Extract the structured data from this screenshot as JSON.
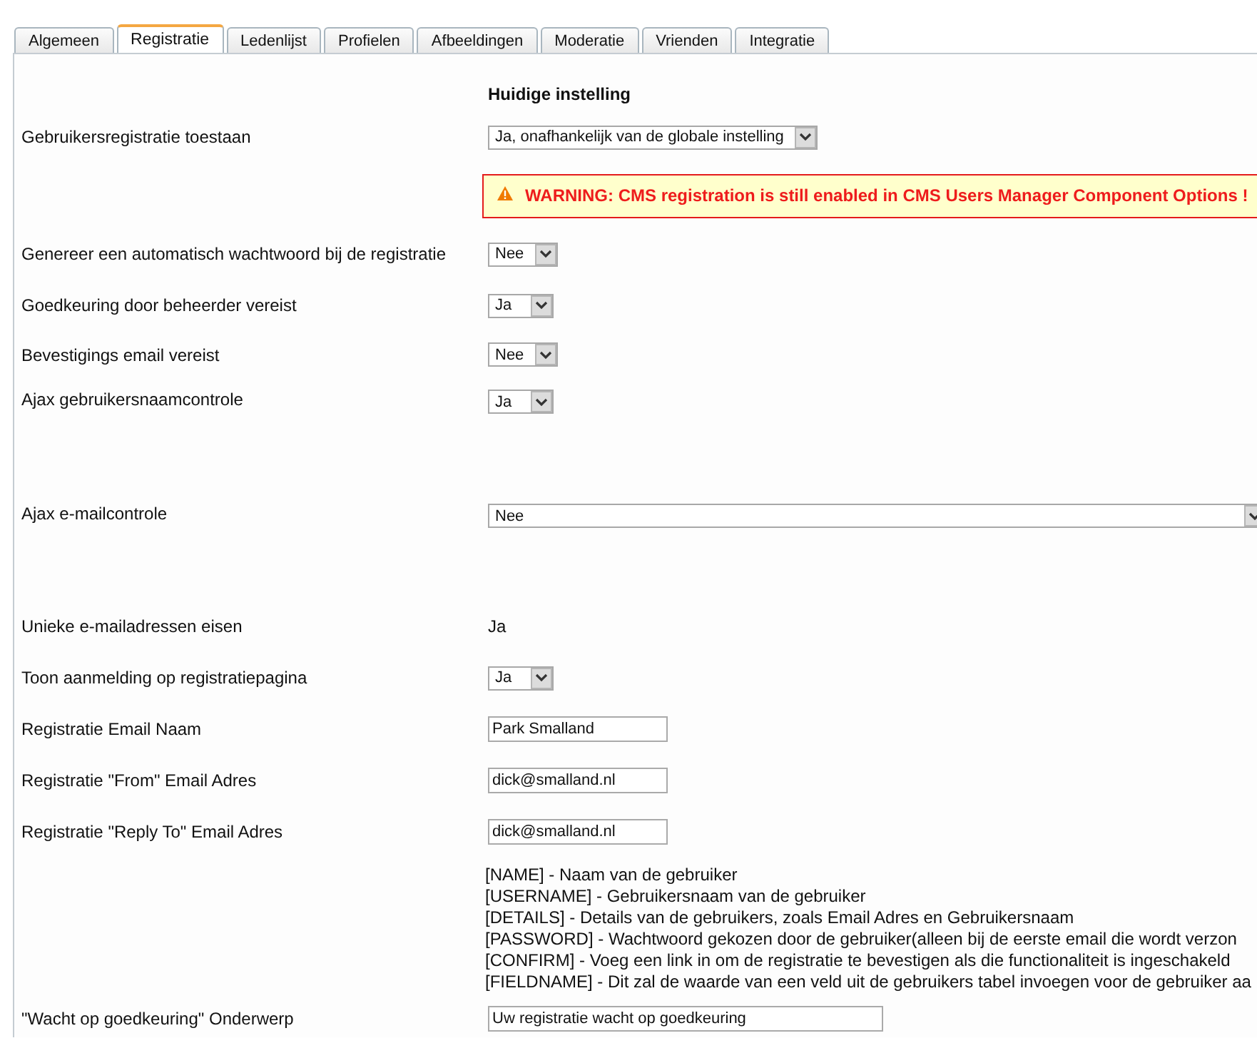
{
  "tabs": [
    {
      "label": "Algemeen",
      "selected": false
    },
    {
      "label": "Registratie",
      "selected": true
    },
    {
      "label": "Ledenlijst",
      "selected": false
    },
    {
      "label": "Profielen",
      "selected": false
    },
    {
      "label": "Afbeeldingen",
      "selected": false
    },
    {
      "label": "Moderatie",
      "selected": false
    },
    {
      "label": "Vrienden",
      "selected": false
    },
    {
      "label": "Integratie",
      "selected": false
    }
  ],
  "column_heading": "Huidige instelling",
  "rows": [
    {
      "kind": "select",
      "label": "Gebruikersregistratie toestaan",
      "value": "Ja, onafhankelijk van de globale instelling"
    },
    {
      "kind": "warning",
      "text": "WARNING: CMS registration is still enabled in CMS Users Manager Component Options !"
    },
    {
      "kind": "select",
      "label": "Genereer een automatisch wachtwoord bij de registratie",
      "value": "Nee"
    },
    {
      "kind": "select",
      "label": "Goedkeuring door beheerder vereist",
      "value": "Ja"
    },
    {
      "kind": "select",
      "label": "Bevestigings email vereist",
      "value": "Nee"
    },
    {
      "kind": "select",
      "label": "Ajax gebruikersnaamcontrole",
      "value": "Ja"
    },
    {
      "kind": "wide_select",
      "label": "Ajax e-mailcontrole",
      "value": "Nee"
    },
    {
      "kind": "text",
      "label": "Unieke e-mailadressen eisen",
      "value": "Ja"
    },
    {
      "kind": "select",
      "label": "Toon aanmelding op registratiepagina",
      "value": "Ja"
    },
    {
      "kind": "input",
      "label": "Registratie Email Naam",
      "value": "Park Smalland"
    },
    {
      "kind": "input",
      "label": "Registratie \"From\" Email Adres",
      "value": "dick@smalland.nl"
    },
    {
      "kind": "input",
      "label": "Registratie \"Reply To\" Email Adres",
      "value": "dick@smalland.nl"
    },
    {
      "kind": "tokens",
      "lines": [
        "[NAME] - Naam van de gebruiker",
        "[USERNAME] - Gebruikersnaam van de gebruiker",
        "[DETAILS] - Details van de gebruikers, zoals Email Adres en Gebruikersnaam",
        "[PASSWORD] - Wachtwoord gekozen door de gebruiker(alleen bij de eerste email die wordt verzon",
        "[CONFIRM] - Voeg een link in om de registratie te bevestigen als die functionaliteit is ingeschakeld",
        "[FIELDNAME] - Dit zal de waarde van een veld uit de gebruikers tabel invoegen voor de gebruiker aa"
      ]
    },
    {
      "kind": "input",
      "label": "\"Wacht op goedkeuring\" Onderwerp",
      "value": "Uw registratie wacht op goedkeuring"
    }
  ]
}
